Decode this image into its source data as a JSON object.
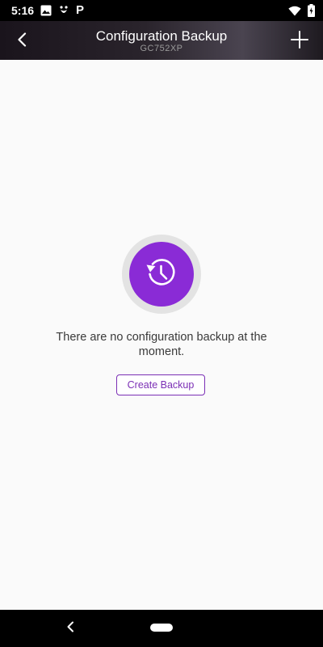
{
  "status_bar": {
    "time": "5:16",
    "left_icons": [
      "image-icon",
      "app-notification-icon",
      "p-app-icon"
    ],
    "p_icon_glyph": "P",
    "right_icons": [
      "wifi-icon",
      "battery-icon"
    ]
  },
  "app_bar": {
    "title": "Configuration Backup",
    "subtitle": "GC752XP",
    "back_icon": "chevron-left-icon",
    "add_icon": "plus-icon"
  },
  "empty_state": {
    "icon": "history-icon",
    "message": "There are no configuration backup at the moment.",
    "button_label": "Create Backup"
  },
  "nav_bar": {
    "back_icon": "nav-back-icon",
    "home_icon": "home-pill-icon"
  },
  "colors": {
    "accent": "#8a2bd6",
    "button_border": "#7b2fb5",
    "background": "#fafafa",
    "ring": "#e3e3e3"
  }
}
